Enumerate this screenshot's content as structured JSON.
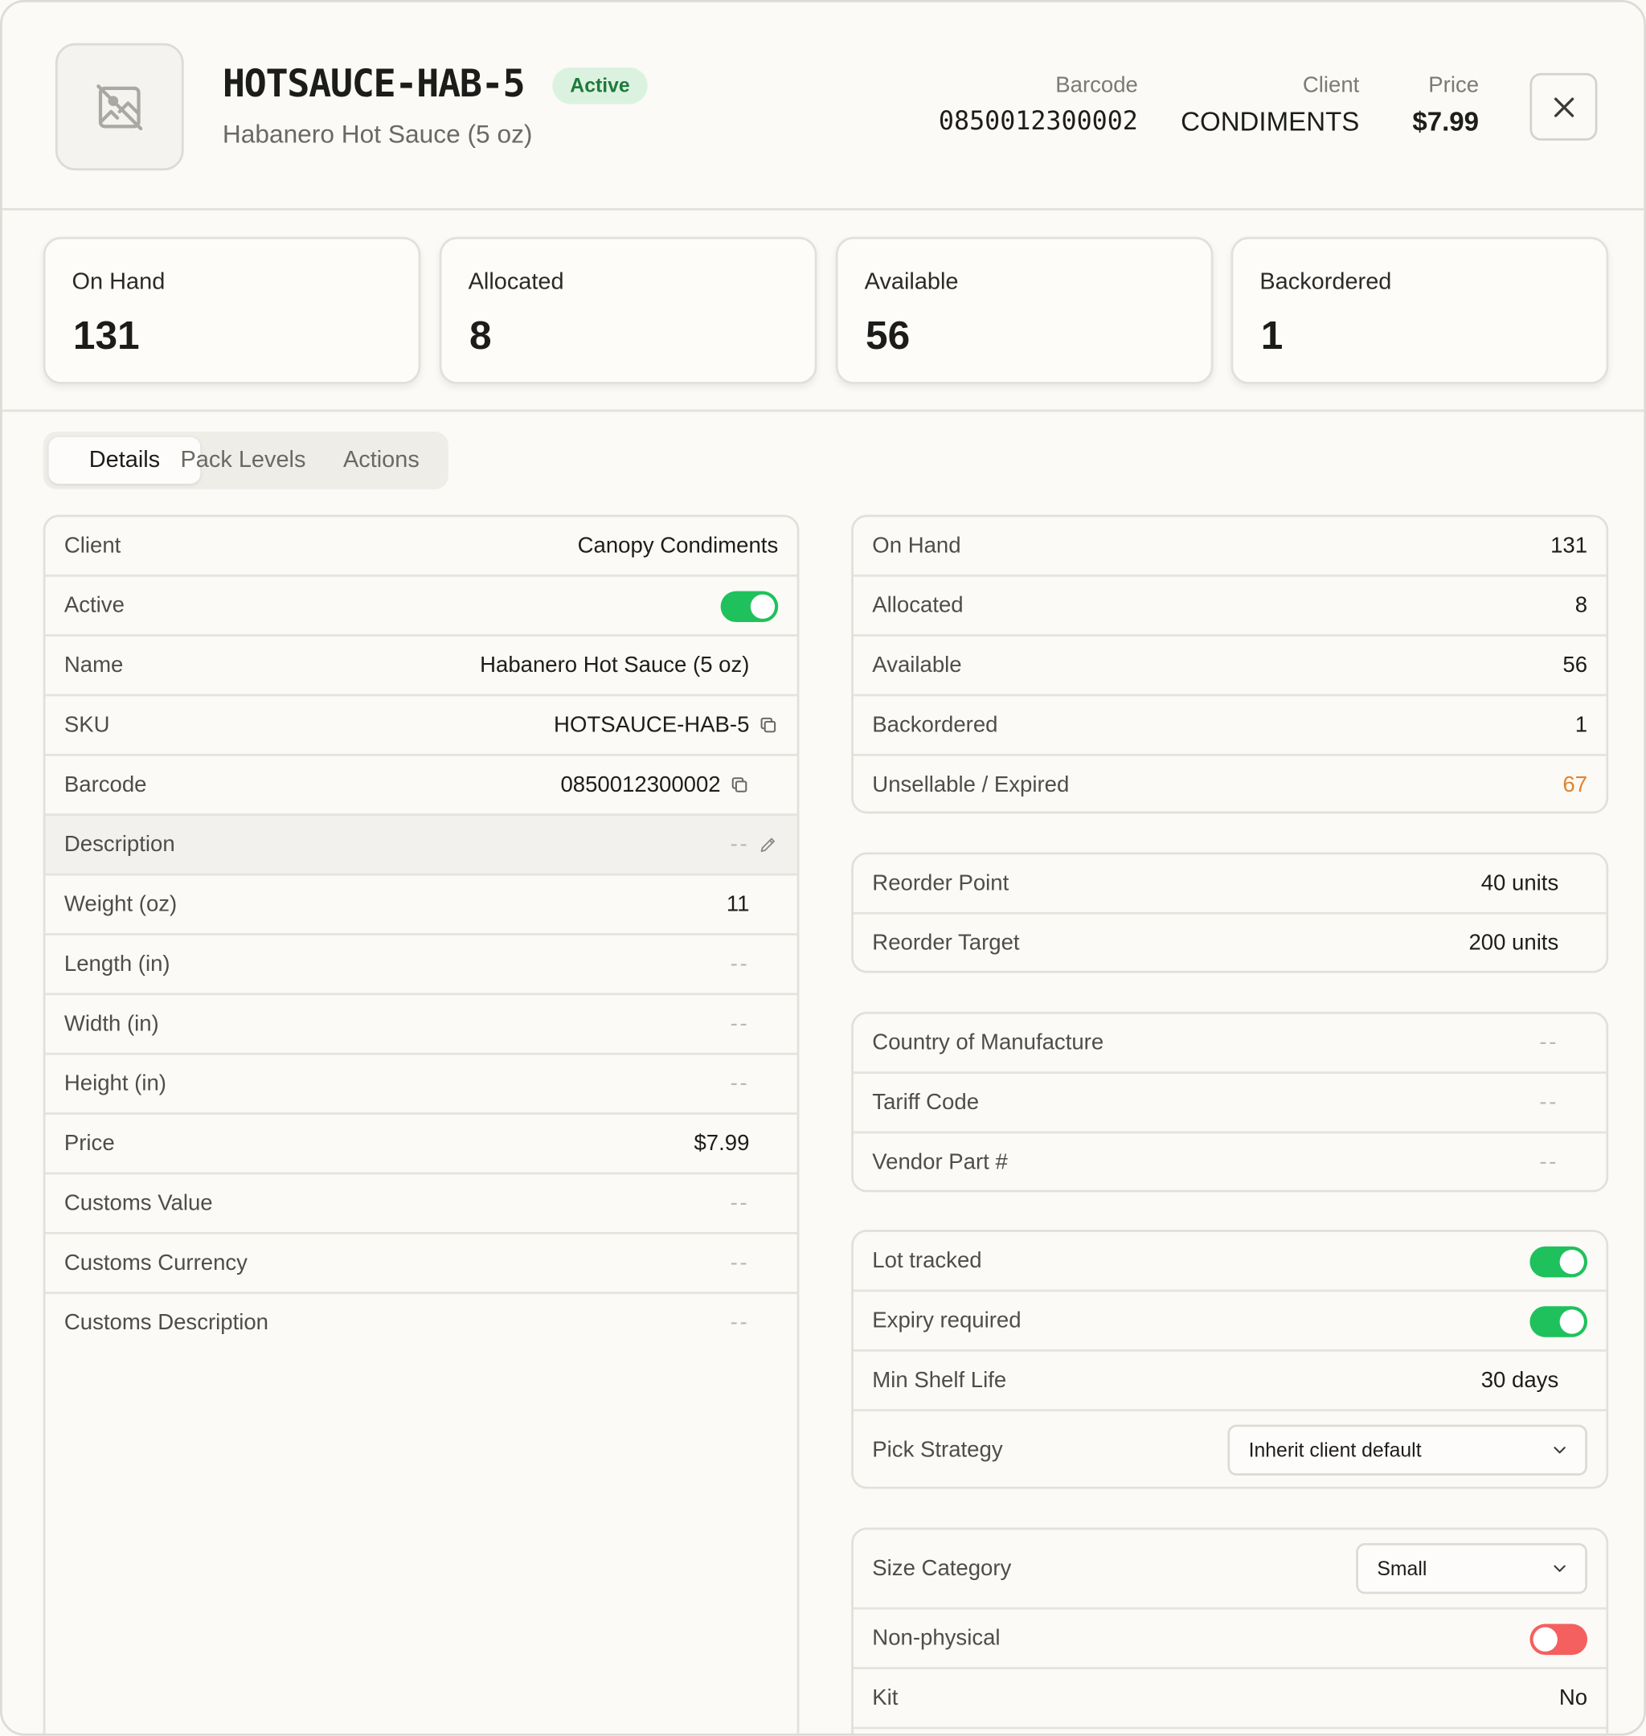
{
  "header": {
    "sku": "HOTSAUCE-HAB-5",
    "status_badge": "Active",
    "product_name": "Habanero Hot Sauce (5 oz)",
    "image_placeholder_icon": "image-off-icon",
    "barcode_label": "Barcode",
    "barcode_value": "0850012300002",
    "client_label": "Client",
    "client_value": "CONDIMENTS",
    "price_label": "Price",
    "price_value": "$7.99",
    "close_icon": "close-icon"
  },
  "stats": [
    {
      "label": "On Hand",
      "value": "131"
    },
    {
      "label": "Allocated",
      "value": "8"
    },
    {
      "label": "Available",
      "value": "56"
    },
    {
      "label": "Backordered",
      "value": "1"
    }
  ],
  "tabs": [
    {
      "label": "Details",
      "active": true
    },
    {
      "label": "Pack Levels",
      "active": false
    },
    {
      "label": "Actions",
      "active": false
    }
  ],
  "details": {
    "client": {
      "label": "Client",
      "value": "Canopy Condiments"
    },
    "active": {
      "label": "Active",
      "on": true
    },
    "name": {
      "label": "Name",
      "value": "Habanero Hot Sauce (5 oz)"
    },
    "sku": {
      "label": "SKU",
      "value": "HOTSAUCE-HAB-5"
    },
    "barcode": {
      "label": "Barcode",
      "value": "0850012300002"
    },
    "description": {
      "label": "Description",
      "value": "--"
    },
    "weight": {
      "label": "Weight (oz)",
      "value": "11"
    },
    "length": {
      "label": "Length (in)",
      "value": "--"
    },
    "width": {
      "label": "Width (in)",
      "value": "--"
    },
    "height": {
      "label": "Height (in)",
      "value": "--"
    },
    "price": {
      "label": "Price",
      "value": "$7.99"
    },
    "customs_value": {
      "label": "Customs Value",
      "value": "--"
    },
    "customs_currency": {
      "label": "Customs Currency",
      "value": "--"
    },
    "customs_description": {
      "label": "Customs Description",
      "value": "--"
    }
  },
  "inventory": {
    "on_hand": {
      "label": "On Hand",
      "value": "131"
    },
    "allocated": {
      "label": "Allocated",
      "value": "8"
    },
    "available": {
      "label": "Available",
      "value": "56"
    },
    "backordered": {
      "label": "Backordered",
      "value": "1"
    },
    "unsellable": {
      "label": "Unsellable / Expired",
      "value": "67",
      "color": "#e2832d"
    }
  },
  "reorder": {
    "point": {
      "label": "Reorder Point",
      "value": "40 units"
    },
    "target": {
      "label": "Reorder Target",
      "value": "200 units"
    }
  },
  "trade": {
    "country": {
      "label": "Country of Manufacture",
      "value": "--"
    },
    "tariff": {
      "label": "Tariff Code",
      "value": "--"
    },
    "vendor_part": {
      "label": "Vendor Part #",
      "value": "--"
    }
  },
  "tracking": {
    "lot_tracked": {
      "label": "Lot tracked",
      "on": true
    },
    "expiry_required": {
      "label": "Expiry required",
      "on": true
    },
    "min_shelf_life": {
      "label": "Min Shelf Life",
      "value": "30 days"
    },
    "pick_strategy": {
      "label": "Pick Strategy",
      "selected": "Inherit client default"
    }
  },
  "physical": {
    "size_category": {
      "label": "Size Category",
      "selected": "Small"
    },
    "non_physical": {
      "label": "Non-physical",
      "on": false
    },
    "kit": {
      "label": "Kit",
      "value": "No"
    }
  },
  "colors": {
    "toggle_on": "#1fc15c",
    "toggle_off": "#f4605f",
    "badge_bg": "#dcf2e0",
    "badge_text": "#1f7a3b",
    "warning": "#e2832d"
  }
}
